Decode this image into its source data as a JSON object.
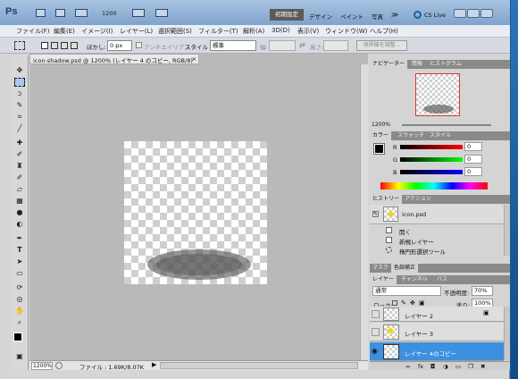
{
  "titlebar": {
    "app_logo": "Ps",
    "zoom_menu": "1200",
    "workspaces": [
      "初期設定",
      "デザイン",
      "ペイント",
      "写真"
    ],
    "more": "≫",
    "cs_live": "CS Live"
  },
  "menu": [
    "ファイル(F)",
    "編集(E)",
    "イメージ(I)",
    "レイヤー(L)",
    "選択範囲(S)",
    "フィルター(T)",
    "解析(A)",
    "3D(D)",
    "表示(V)",
    "ウィンドウ(W)",
    "ヘルプ(H)"
  ],
  "options": {
    "feather_label": "ぼかし:",
    "feather_value": "0 px",
    "antialias_label": "アンチエイリアス",
    "style_label": "スタイル :",
    "style_value": "標準",
    "width_label": "幅:",
    "height_label": "高さ:",
    "refine_edge": "境界線を調整..."
  },
  "document": {
    "tab_title": "icon-shadow.psd @ 1200% (レイヤー 4 のコピー, RGB/8)",
    "close": "×",
    "zoom": "1200%",
    "file_info": "ファイル : 1.69K/8.07K"
  },
  "navigator": {
    "tabs": [
      "ナビゲーター",
      "情報",
      "ヒストグラム"
    ],
    "zoom": "1200%"
  },
  "color": {
    "tabs": [
      "カラー",
      "スウォッチ",
      "スタイル"
    ],
    "r_label": "R",
    "r_value": "0",
    "g_label": "G",
    "g_value": "0",
    "b_label": "B",
    "b_value": "0"
  },
  "history": {
    "tabs": [
      "ヒストリー",
      "アクション"
    ],
    "snapshot": "icon.psd",
    "items": [
      "開く",
      "新規レイヤー",
      "楕円形選択ツール"
    ]
  },
  "masks": {
    "tabs": [
      "マスク",
      "色調補正"
    ]
  },
  "layers": {
    "tabs": [
      "レイヤー",
      "チャンネル",
      "パス"
    ],
    "blend_mode": "通常",
    "opacity_label": "不透明度:",
    "opacity_value": "70%",
    "lock_label": "ロック:",
    "fill_label": "塗り:",
    "fill_value": "100%",
    "rows": [
      "レイヤー 2",
      "レイヤー 3",
      "レイヤー 4のコピー"
    ]
  },
  "colors": {
    "accent": "#3d8fe0",
    "titlebar": "#8eb0d6"
  }
}
